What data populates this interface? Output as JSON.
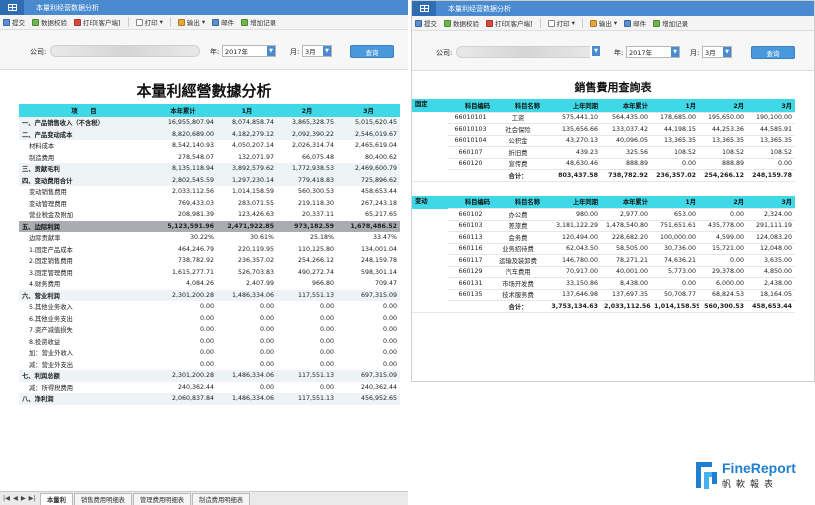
{
  "left": {
    "window_title": "本量利经营数据分析",
    "toolbar": [
      "提交",
      "数据校验",
      "打印[客户端]",
      "打印",
      "输出",
      "邮件",
      "增加记录"
    ],
    "filter": {
      "company_label": "公司:",
      "year_label": "年:",
      "year_value": "2017年",
      "month_label": "月:",
      "month_value": "3月",
      "query_label": "查询"
    },
    "report_title": "本量利經營數據分析",
    "headers": [
      "项　　目",
      "本年累计",
      "1月",
      "2月",
      "3月"
    ],
    "rows": [
      {
        "style": "lvl1",
        "cells": [
          "一、产品销售收入（不含税）",
          "16,955,807.94",
          "8,074,858.74",
          "3,865,328.75",
          "5,015,620.45"
        ]
      },
      {
        "style": "lvl1",
        "cells": [
          "二、产品变动成本",
          "8,820,689.00",
          "4,182,279.12",
          "2,092,390.22",
          "2,546,019.67"
        ]
      },
      {
        "style": "ind",
        "cells": [
          "材料成本",
          "8,542,140.93",
          "4,050,207.14",
          "2,026,314.74",
          "2,465,619.04"
        ]
      },
      {
        "style": "ind",
        "cells": [
          "制造费用",
          "278,548.07",
          "132,071.97",
          "66,075.48",
          "80,400.62"
        ]
      },
      {
        "style": "lvl1",
        "cells": [
          "三、贡献毛利",
          "8,135,118.94",
          "3,892,579.62",
          "1,772,938.53",
          "2,469,600.79"
        ]
      },
      {
        "style": "lvl1",
        "cells": [
          "四、变动费用合计",
          "2,802,545.59",
          "1,297,230.14",
          "779,418.83",
          "725,896.62"
        ]
      },
      {
        "style": "ind",
        "cells": [
          "变动销售费用",
          "2,033,112.56",
          "1,014,158.59",
          "560,300.53",
          "458,653.44"
        ]
      },
      {
        "style": "ind",
        "cells": [
          "变动管理费用",
          "769,433.03",
          "283,071.55",
          "219,118.30",
          "267,243.18"
        ]
      },
      {
        "style": "ind",
        "cells": [
          "营业税金及附加",
          "208,981.39",
          "123,426.63",
          "20,337.11",
          "65,217.65"
        ]
      },
      {
        "style": "grey",
        "cells": [
          "五、边际利润",
          "5,123,591.96",
          "2,471,922.85",
          "973,182.59",
          "1,678,486.52"
        ]
      },
      {
        "style": "ind",
        "cells": [
          "边际贡献率",
          "30.22%",
          "30.61%",
          "25.18%",
          "33.47%"
        ]
      },
      {
        "style": "ind",
        "cells": [
          "1.固定产品成本",
          "464,246.79",
          "220,119.95",
          "110,125.80",
          "134,001.04"
        ]
      },
      {
        "style": "ind",
        "cells": [
          "2.固定销售费用",
          "738,782.92",
          "236,357.02",
          "254,266.12",
          "248,159.78"
        ]
      },
      {
        "style": "ind",
        "cells": [
          "3.固定管理费用",
          "1,615,277.71",
          "526,703.83",
          "490,272.74",
          "598,301.14"
        ]
      },
      {
        "style": "ind",
        "cells": [
          "4.财务费用",
          "4,084.26",
          "2,407.99",
          "966.80",
          "709.47"
        ]
      },
      {
        "style": "lvl1",
        "cells": [
          "六、营业利润",
          "2,301,200.28",
          "1,486,334.06",
          "117,551.13",
          "697,315.09"
        ]
      },
      {
        "style": "ind",
        "cells": [
          "5.其他业务收入",
          "0.00",
          "0.00",
          "0.00",
          "0.00"
        ]
      },
      {
        "style": "ind",
        "cells": [
          "6.其他业务支出",
          "0.00",
          "0.00",
          "0.00",
          "0.00"
        ]
      },
      {
        "style": "ind",
        "cells": [
          "7.资产减值损失",
          "0.00",
          "0.00",
          "0.00",
          "0.00"
        ]
      },
      {
        "style": "ind",
        "cells": [
          "8.投资收益",
          "0.00",
          "0.00",
          "0.00",
          "0.00"
        ]
      },
      {
        "style": "ind",
        "cells": [
          "加：营业外收入",
          "0.00",
          "0.00",
          "0.00",
          "0.00"
        ]
      },
      {
        "style": "ind",
        "cells": [
          "减：营业外支出",
          "0.00",
          "0.00",
          "0.00",
          "0.00"
        ]
      },
      {
        "style": "lvl1",
        "cells": [
          "七、利润总额",
          "2,301,200.28",
          "1,486,334.06",
          "117,551.13",
          "697,315.09"
        ]
      },
      {
        "style": "ind",
        "cells": [
          "减：所得税费用",
          "240,362.44",
          "0.00",
          "0.00",
          "240,362.44"
        ]
      },
      {
        "style": "lvl1",
        "cells": [
          "八、净利润",
          "2,060,837.84",
          "1,486,334.06",
          "117,551.13",
          "456,952.65"
        ]
      }
    ],
    "sheet_tabs": [
      "本量利",
      "销售费用明细表",
      "管理费用明细表",
      "制造费用明细表"
    ]
  },
  "right": {
    "window_title": "本量利经营数据分析",
    "toolbar": [
      "提交",
      "数据校验",
      "打印[客户端]",
      "打印",
      "输出",
      "邮件",
      "增加记录"
    ],
    "filter": {
      "company_label": "公司:",
      "year_label": "年:",
      "year_value": "2017年",
      "month_label": "月:",
      "month_value": "3月",
      "query_label": "查询"
    },
    "report_title": "銷售費用查詢表",
    "fixed_section": {
      "side_label": "固定",
      "headers": [
        "科目编码",
        "科目名称",
        "上年同期",
        "本年累计",
        "1月",
        "2月",
        "3月"
      ],
      "rows": [
        [
          "66010101",
          "工资",
          "575,441.10",
          "564,435.00",
          "178,685.00",
          "195,650.00",
          "190,100.00"
        ],
        [
          "66010103",
          "社会保险",
          "135,656.66",
          "133,037.42",
          "44,198.15",
          "44,253.36",
          "44,585.91"
        ],
        [
          "66010104",
          "公积金",
          "43,270.13",
          "40,096.05",
          "13,365.35",
          "13,365.35",
          "13,365.35"
        ],
        [
          "660107",
          "折旧费",
          "439.23",
          "325.56",
          "108.52",
          "108.52",
          "108.52"
        ],
        [
          "660120",
          "宣传费",
          "48,630.46",
          "888.89",
          "0.00",
          "888.89",
          "0.00"
        ]
      ],
      "total": [
        "合计：",
        "803,437.58",
        "738,782.92",
        "236,357.02",
        "254,266.12",
        "248,159.78"
      ]
    },
    "variable_section": {
      "side_label": "变动",
      "headers": [
        "科目编码",
        "科目名称",
        "上年同期",
        "本年累计",
        "1月",
        "2月",
        "3月"
      ],
      "rows": [
        [
          "660102",
          "办公费",
          "980.00",
          "2,977.00",
          "653.00",
          "0.00",
          "2,324.00"
        ],
        [
          "660103",
          "差旅费",
          "3,181,122.29",
          "1,478,540.80",
          "751,651.61",
          "435,778.00",
          "291,111.19"
        ],
        [
          "660113",
          "会务费",
          "120,494.00",
          "228,682.20",
          "100,000.00",
          "4,599.00",
          "124,083.20"
        ],
        [
          "660116",
          "业务招待费",
          "62,043.50",
          "58,505.00",
          "30,736.00",
          "15,721.00",
          "12,048.00"
        ],
        [
          "660117",
          "运输及装卸费",
          "146,780.00",
          "78,271.21",
          "74,636.21",
          "0.00",
          "3,635.00"
        ],
        [
          "660129",
          "汽车费用",
          "70,917.00",
          "40,001.00",
          "5,773.00",
          "29,378.00",
          "4,850.00"
        ],
        [
          "660131",
          "市场开发费",
          "33,150.86",
          "8,438.00",
          "0.00",
          "6,000.00",
          "2,438.00"
        ],
        [
          "660135",
          "技术服务费",
          "137,646.98",
          "137,697.35",
          "50,708.77",
          "68,824.53",
          "18,164.05"
        ]
      ],
      "total": [
        "合计：",
        "3,753,134.63",
        "2,033,112.56",
        "1,014,158.59",
        "560,300.53",
        "458,653.44"
      ]
    }
  },
  "logo": {
    "name": "FineReport",
    "subtitle": "帆軟報表",
    "color": "#1f7fd1"
  }
}
